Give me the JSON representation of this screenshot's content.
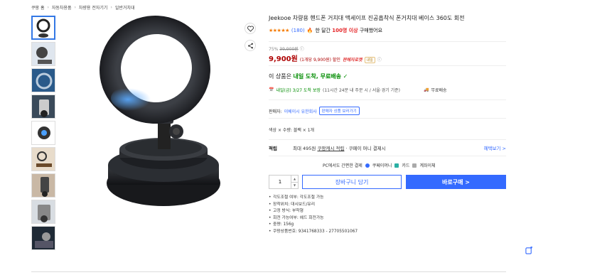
{
  "breadcrumb": [
    "쿠팡 홈",
    "자동차용품",
    "차량용 전자기기",
    "일반거치대"
  ],
  "product": {
    "title": "Jeekooe 차량용 핸드폰 거치대 맥세이프 진공흡착식 폰거치대 베이스 360도 회전",
    "stars": "★★★★★",
    "review_count": "(180)",
    "purchase_note_prefix": "한 달간",
    "purchase_note_highlight": "100명 이상",
    "purchase_note_suffix": "구매했어요"
  },
  "price": {
    "discount_rate": "75%",
    "original_price": "39,900원",
    "price": "9,900원",
    "unit_price": "(1개당 9,900원) 할인",
    "rocket_label": "판매자로켓",
    "badge": "내일"
  },
  "delivery": {
    "head_prefix": "이 상품은",
    "head_highlight": "내일 도착, 무료배송",
    "detail": "내일(금) 3/27 도착 보장",
    "detail_note": "(11시간 24분 내 주문 시 / 서울⋅경기 기준)",
    "free_ship": "무료배송"
  },
  "seller": {
    "label": "판매자:",
    "name": "이베이시 유한회사",
    "more_btn": "판매자 상품 보러가기"
  },
  "option": "색상 × 수량: 블랙 × 1개",
  "benefit": {
    "label": "적립",
    "text": "최대 495원",
    "link": "쿠팡캐시 적립",
    "text2": "· 쿠페이 머니 결제시",
    "more": "혜택보기 >"
  },
  "payment": {
    "label": "PC에서도 간편한 결제",
    "options": [
      "쿠페이머니",
      "카드",
      "계좌이체"
    ]
  },
  "purchase": {
    "quantity": "1",
    "cart_label": "장바구니 담기",
    "buy_label": "바로구매 >"
  },
  "specs": [
    "각도조절 여부: 각도조절 가능",
    "장착위치: 대시보드/유리",
    "고정 방식: 부착형",
    "회전 가능여부: 헤드 회전가능",
    "중량: 156g",
    "쿠팡상품번호: 9341768333 - 27705501067"
  ],
  "colors": {
    "accent": "#346aff",
    "price_red": "#ae0000",
    "green": "#008c00",
    "star": "#f57a00"
  }
}
